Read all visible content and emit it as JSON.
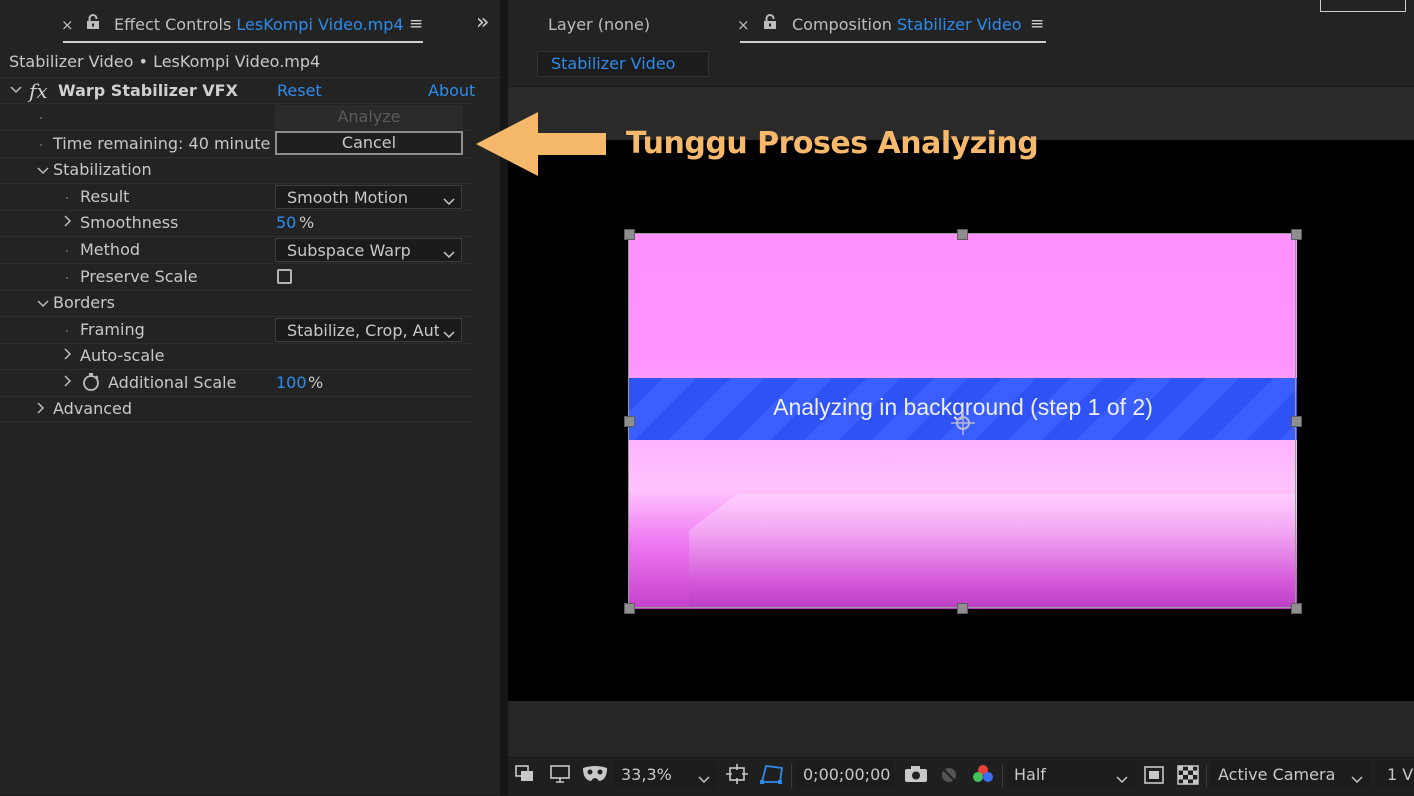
{
  "effect_controls": {
    "tab": {
      "close": "×",
      "prefix": "Effect Controls",
      "file": "LesKompi Video.mp4",
      "menu": "≡"
    },
    "expand_panels": "»",
    "layer_path": "Stabilizer Video • LesKompi Video.mp4",
    "effect": {
      "fx_symbol": "fx",
      "name": "Warp Stabilizer VFX",
      "reset": "Reset",
      "about": "About"
    },
    "analyze_button": "Analyze",
    "time_remaining": "Time remaining: 40 minute",
    "cancel_button": "Cancel",
    "sections": {
      "stabilization": "Stabilization",
      "result_label": "Result",
      "result_value": "Smooth Motion",
      "smoothness_label": "Smoothness",
      "smoothness_value": "50",
      "smoothness_unit": "%",
      "method_label": "Method",
      "method_value": "Subspace Warp",
      "preserve_scale_label": "Preserve Scale",
      "preserve_scale_checked": false,
      "borders": "Borders",
      "framing_label": "Framing",
      "framing_value": "Stabilize, Crop, Auto-scale",
      "auto_scale_label": "Auto-scale",
      "additional_scale_label": "Additional Scale",
      "additional_scale_value": "100",
      "additional_scale_unit": "%",
      "advanced": "Advanced"
    }
  },
  "viewer": {
    "layer_tab": "Layer (none)",
    "comp_tab": {
      "close": "×",
      "prefix": "Composition",
      "name": "Stabilizer Video",
      "menu": "≡"
    },
    "comp_name_tab": "Stabilizer Video",
    "banner_text": "Analyzing in background (step 1 of 2)",
    "controls": {
      "zoom": "33,3%",
      "timecode": "0;00;00;00",
      "resolution": "Half",
      "camera": "Active Camera",
      "views": "1 V"
    }
  },
  "annotation": {
    "text": "Tunggu Proses Analyzing",
    "color": "#f6b96c"
  },
  "colors": {
    "accent": "#2d8ceb",
    "panel_bg": "#232323",
    "banner": "#2f52f5"
  }
}
